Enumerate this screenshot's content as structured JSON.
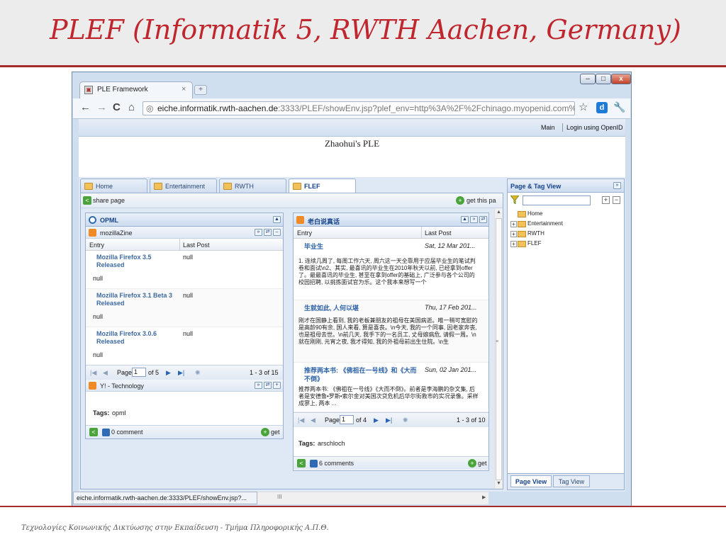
{
  "slide": {
    "title": "PLEF (Informatik 5, RWTH Aachen, Germany)",
    "footer": "Τεχνολογίες Κοινωνικής Δικτύωσης στην Εκπαίδευση - Τμήμα Πληροφορικής Α.Π.Θ."
  },
  "browser": {
    "tab_title": "PLE Framework",
    "tab_close": "×",
    "window_buttons": {
      "minimize": "–",
      "maximize": "□",
      "close": "x"
    },
    "url_host": "eiche.informatik.rwth-aachen.de",
    "url_rest": ":3333/PLEF/showEnv.jsp?plef_env=http%3A%2F%2Fchinago.myopenid.com%2F",
    "status_url": "eiche.informatik.rwth-aachen.de:3333/PLEF/showEnv.jsp?...",
    "nav": {
      "back": "←",
      "forward": "→",
      "reload": "C",
      "home": "⌂"
    }
  },
  "page": {
    "top_links": [
      "Main",
      "Login using OpenID"
    ],
    "title": "Zhaohui's PLE",
    "tabs": [
      "Home",
      "Entertainment",
      "RWTH",
      "FLEF"
    ],
    "share_label": "share page",
    "get_this_label": "get this pa",
    "opml_widget": {
      "title": "OPML",
      "feed_title": "mozillaZine",
      "columns": [
        "Entry",
        "Last Post"
      ],
      "rows": [
        {
          "title": "Mozilla Firefox 3.5 Released",
          "post": "null",
          "extra": "null"
        },
        {
          "title": "Mozilla Firefox 3.1 Beta 3 Released",
          "post": "null",
          "extra": "null"
        },
        {
          "title": "Mozilla Firefox 3.0.6 Released",
          "post": "null",
          "extra": "null"
        }
      ],
      "pager": {
        "page_label": "Page",
        "page_value": "1",
        "of_label": "of 5",
        "range": "1 - 3 of 15"
      },
      "feed2_title": "Y! - Technology",
      "tags_label": "Tags:",
      "tags_value": "opml",
      "comments": "0 comment",
      "get_label": "get"
    },
    "cn_widget": {
      "title": "老白说真话",
      "columns": [
        "Entry",
        "Last Post"
      ],
      "rows": [
        {
          "title": "毕业生",
          "date": "Sat, 12 Mar 201...",
          "body": "1. 连续几周了, 每周工作六天, 周六这一天全靠用于应届毕业生的笔试判卷和面试\\n2、其实, 最喜讯的毕业生在2010年秋天以前, 已经拿到offer了。最最喜讯的毕业生, 甚至在拿到offer的基础上, 广泛参与各个公司的校园招聘, 以挑拣面试官为乐。这个我本来想写一个"
        },
        {
          "title": "生就如此, 人何以堪",
          "date": "Thu, 17 Feb 201...",
          "body": "刚才在国静上看到, 我的老板兼朋友的祖母在美国病逝。唯一稍可宽慰的是高龄90有余, 国人来看, 算是喜丧。\\n今天, 我的一个同事, 因老家奔丧, 也是祖母去世。\\n前几天, 我手下的一名员工, 丈母娘病危, 请假一周。\\n就在刚刚, 元宵之夜, 我才得知, 我的外祖母前出生住院。\\n生"
        },
        {
          "title": "推荐两本书: 《佛祖在一号线》和《大而不倒》",
          "date": "Sun, 02 Jan 201...",
          "body": "推荐两本书: 《佛祖在一号线》《大而不倒》。前者是李海鹏的杂文集, 后者是安德鲁•罗斯•索尔金对美国次贷危机后华尔街救市的实况录像。采样成寥上, 两本 ..."
        }
      ],
      "pager": {
        "page_label": "Page",
        "page_value": "1",
        "of_label": "of 4",
        "range": "1 - 3 of 10"
      },
      "tags_label": "Tags:",
      "tags_value": "arschloch",
      "comments": "6 comments",
      "get_label": "get"
    },
    "side_panel": {
      "title": "Page & Tag View",
      "tree": [
        "Home",
        "Entertainment",
        "RWTH",
        "FLEF"
      ],
      "tabs": [
        "Page View",
        "Tag View"
      ]
    },
    "status_scroll_mark": "III"
  }
}
